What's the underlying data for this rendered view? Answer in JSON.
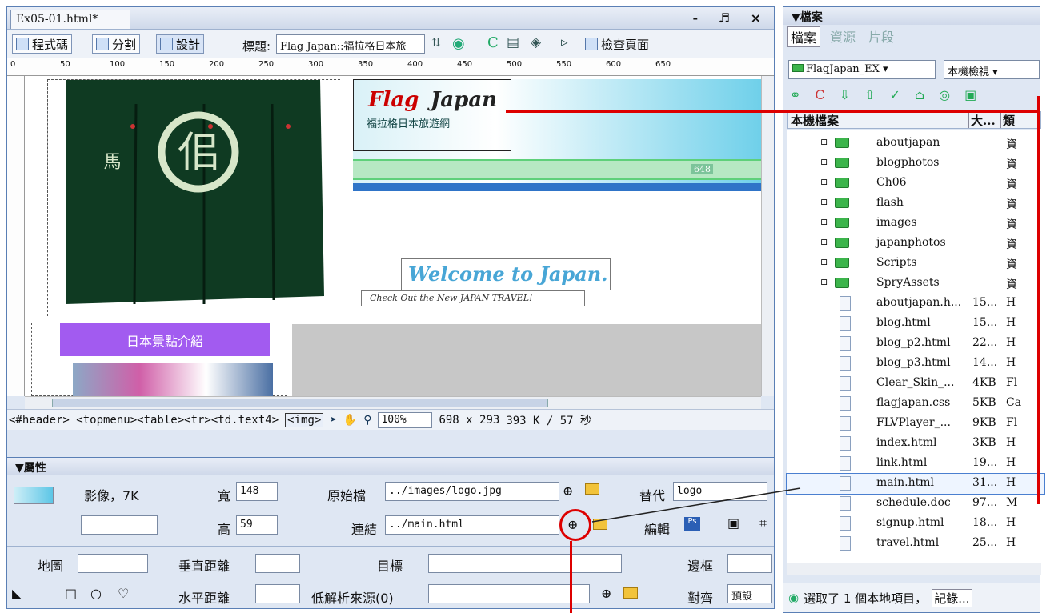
{
  "editor": {
    "tab_title": "Ex05-01.html*",
    "window_controls": "- ♬ ×",
    "toolbar": {
      "code_label": "程式碼",
      "split_label": "分割",
      "design_label": "設計",
      "title_label": "標題:",
      "title_value": "Flag Japan::福拉格日本旅",
      "check_page_label": "檢查頁面"
    },
    "ruler_marks": [
      "0",
      "50",
      "100",
      "150",
      "200",
      "250",
      "300",
      "350",
      "400",
      "450",
      "500",
      "550",
      "600",
      "650"
    ],
    "canvas": {
      "logo_text_flag": "Flag",
      "logo_text_japan": "Japan",
      "logo_subtitle": "福拉格日本旅遊網",
      "menu_size_label": "648",
      "welcome_text": "Welcome to Japan.",
      "checkout_text": "Check Out the New JAPAN TRAVEL!",
      "nav_purple_label": "日本景點介紹"
    },
    "statusbar": {
      "tag_path": "<#header> <topmenu><table><tr><td.text4>",
      "selected_tag": "<img>",
      "zoom": "100%",
      "dimensions": "698 x 293",
      "size_time": "393 K / 57 秒"
    }
  },
  "properties": {
    "panel_title": "▼屬性",
    "image_label": "影像，7K",
    "width_label": "寬",
    "width_value": "148",
    "height_label": "高",
    "height_value": "59",
    "src_label": "原始檔",
    "src_value": "../images/logo.jpg",
    "link_label": "連結",
    "link_value": "../main.html",
    "alt_label": "替代",
    "alt_value": "logo",
    "edit_label": "編輯",
    "map_label": "地圖",
    "vspace_label": "垂直距離",
    "target_label": "目標",
    "border_label": "邊框",
    "hspace_label": "水平距離",
    "lowsrc_label": "低解析來源(0)",
    "align_label": "對齊",
    "align_value": "預設"
  },
  "files_panel": {
    "panel_title": "▼檔案",
    "tabs": [
      "檔案",
      "資源",
      "片段"
    ],
    "site_select": "FlagJapan_EX",
    "view_select": "本機檢視",
    "columns": [
      "本機檔案",
      "大...",
      "類"
    ],
    "items": [
      {
        "name": "aboutjapan",
        "size": "",
        "type": "資",
        "folder": true
      },
      {
        "name": "blogphotos",
        "size": "",
        "type": "資",
        "folder": true
      },
      {
        "name": "Ch06",
        "size": "",
        "type": "資",
        "folder": true
      },
      {
        "name": "flash",
        "size": "",
        "type": "資",
        "folder": true
      },
      {
        "name": "images",
        "size": "",
        "type": "資",
        "folder": true
      },
      {
        "name": "japanphotos",
        "size": "",
        "type": "資",
        "folder": true
      },
      {
        "name": "Scripts",
        "size": "",
        "type": "資",
        "folder": true
      },
      {
        "name": "SpryAssets",
        "size": "",
        "type": "資",
        "folder": true
      },
      {
        "name": "aboutjapan.h...",
        "size": "15...",
        "type": "H",
        "folder": false
      },
      {
        "name": "blog.html",
        "size": "15...",
        "type": "H",
        "folder": false
      },
      {
        "name": "blog_p2.html",
        "size": "22...",
        "type": "H",
        "folder": false
      },
      {
        "name": "blog_p3.html",
        "size": "14...",
        "type": "H",
        "folder": false
      },
      {
        "name": "Clear_Skin_...",
        "size": "4KB",
        "type": "Fl",
        "folder": false
      },
      {
        "name": "flagjapan.css",
        "size": "5KB",
        "type": "Ca",
        "folder": false
      },
      {
        "name": "FLVPlayer_...",
        "size": "9KB",
        "type": "Fl",
        "folder": false
      },
      {
        "name": "index.html",
        "size": "3KB",
        "type": "H",
        "folder": false
      },
      {
        "name": "link.html",
        "size": "19...",
        "type": "H",
        "folder": false
      },
      {
        "name": "main.html",
        "size": "31...",
        "type": "H",
        "folder": false
      },
      {
        "name": "schedule.doc",
        "size": "97...",
        "type": "M",
        "folder": false
      },
      {
        "name": "signup.html",
        "size": "18...",
        "type": "H",
        "folder": false
      },
      {
        "name": "travel.html",
        "size": "25...",
        "type": "H",
        "folder": false
      }
    ],
    "status_text": "選取了 1 個本地項目，",
    "log_button": "記錄..."
  },
  "colors": {
    "annotation_red": "#d00000",
    "nav_purple": "#a25bf0",
    "noren_green": "#0f3a22"
  }
}
